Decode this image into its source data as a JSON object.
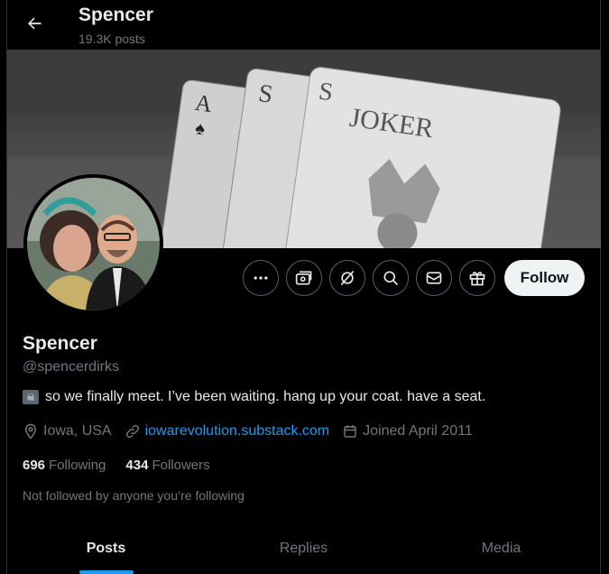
{
  "header": {
    "title": "Spencer",
    "post_count": "19.3K posts"
  },
  "profile": {
    "display_name": "Spencer",
    "handle": "@spencerdirks",
    "bio": "so we finally meet. I’ve been waiting. hang up your coat. have a seat.",
    "bio_emoji": "☠",
    "location": "Iowa, USA",
    "website": "iowarevolution.substack.com",
    "joined": "Joined April 2011",
    "following_count": "696",
    "following_label": "Following",
    "followers_count": "434",
    "followers_label": "Followers",
    "followed_by_note": "Not followed by anyone you’re following"
  },
  "banner": {
    "card_text": "JOKER"
  },
  "actions": {
    "follow_label": "Follow",
    "icons": [
      "more-icon",
      "subscribe-icon",
      "grok-icon",
      "search-icon",
      "message-icon",
      "gift-icon"
    ]
  },
  "tabs": [
    {
      "label": "Posts",
      "active": true
    },
    {
      "label": "Replies",
      "active": false
    },
    {
      "label": "Media",
      "active": false
    }
  ],
  "colors": {
    "accent": "#1d9bf0",
    "background": "#000000",
    "text_primary": "#e7e9ea",
    "text_secondary": "#71767b"
  }
}
